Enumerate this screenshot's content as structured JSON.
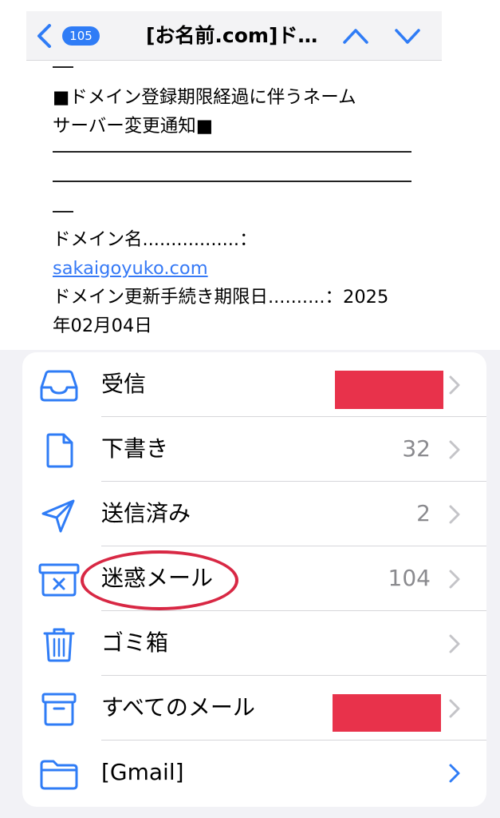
{
  "navbar": {
    "badge_count": "105",
    "title": "[お名前.com]ド…"
  },
  "email": {
    "lines": [
      "■ドメイン登録期限経過に伴うネーム",
      "サーバー変更通知■",
      "ドメイン名.................：",
      "sakaigoyuko.com",
      "ドメイン更新手続き期限日..........：2025",
      "年02月04日"
    ]
  },
  "mailboxes": [
    {
      "label": "受信",
      "count": "",
      "icon": "inbox-icon",
      "redacted": true
    },
    {
      "label": "下書き",
      "count": "32",
      "icon": "document-icon"
    },
    {
      "label": "送信済み",
      "count": "2",
      "icon": "paper-plane-icon"
    },
    {
      "label": "迷惑メール",
      "count": "104",
      "icon": "junk-icon"
    },
    {
      "label": "ゴミ箱",
      "count": "",
      "icon": "trash-icon"
    },
    {
      "label": "すべてのメール",
      "count": "",
      "icon": "archive-box-icon",
      "redacted": true
    },
    {
      "label": "[Gmail]",
      "count": "",
      "icon": "folder-icon"
    }
  ],
  "colors": {
    "accent": "#2f7cf6",
    "redaction": "#e8324b",
    "annotation_circle": "#d82844"
  }
}
